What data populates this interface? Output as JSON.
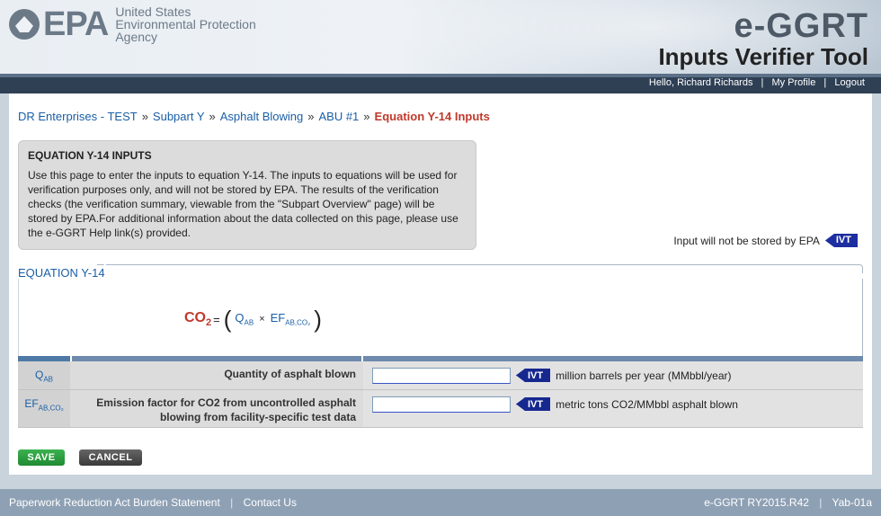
{
  "header": {
    "logo_text": "EPA",
    "agency_lines": [
      "United States",
      "Environmental Protection",
      "Agency"
    ],
    "app_name": "e-GGRT",
    "app_subtitle": "Inputs Verifier Tool"
  },
  "user_bar": {
    "greeting": "Hello, Richard Richards",
    "my_profile": "My Profile",
    "logout": "Logout",
    "separator": "|"
  },
  "breadcrumb": {
    "items": [
      "DR Enterprises - TEST",
      "Subpart Y",
      "Asphalt Blowing",
      "ABU #1"
    ],
    "current": "Equation Y-14 Inputs",
    "separator": "»"
  },
  "info_box": {
    "title": "EQUATION Y-14 INPUTS",
    "text": "Use this page to enter the inputs to equation Y-14. The inputs to equations will be used for verification purposes only, and will not be stored by EPA. The results of the verification checks (the verification summary, viewable from the \"Subpart Overview\" page) will be stored by EPA.For additional information about the data collected on this page, please use the e-GGRT Help link(s) provided."
  },
  "notice": {
    "text": "Input will not be stored by EPA",
    "tag": "IVT"
  },
  "equation": {
    "title": "EQUATION Y-14",
    "lhs": "CO",
    "lhs_sub": "2",
    "equals": "=",
    "open_paren": "(",
    "close_paren": ")",
    "term1": "Q",
    "term1_sub": "AB",
    "times": "×",
    "term2": "EF",
    "term2_sub": "AB,CO₂"
  },
  "inputs": [
    {
      "symbol": "Q",
      "symbol_sub": "AB",
      "label": "Quantity of asphalt blown",
      "value": "",
      "tag": "IVT",
      "unit": "million barrels per year (MMbbl/year)"
    },
    {
      "symbol": "EF",
      "symbol_sub": "AB,CO₂",
      "label": "Emission factor for CO2 from uncontrolled asphalt blowing from facility-specific test data",
      "value": "",
      "tag": "IVT",
      "unit": "metric tons CO2/MMbbl asphalt blown"
    }
  ],
  "buttons": {
    "save": "SAVE",
    "cancel": "CANCEL"
  },
  "footer": {
    "paperwork": "Paperwork Reduction Act Burden Statement",
    "contact": "Contact Us",
    "version": "e-GGRT RY2015.R42",
    "build": "Yab-01a",
    "separator": "|"
  }
}
